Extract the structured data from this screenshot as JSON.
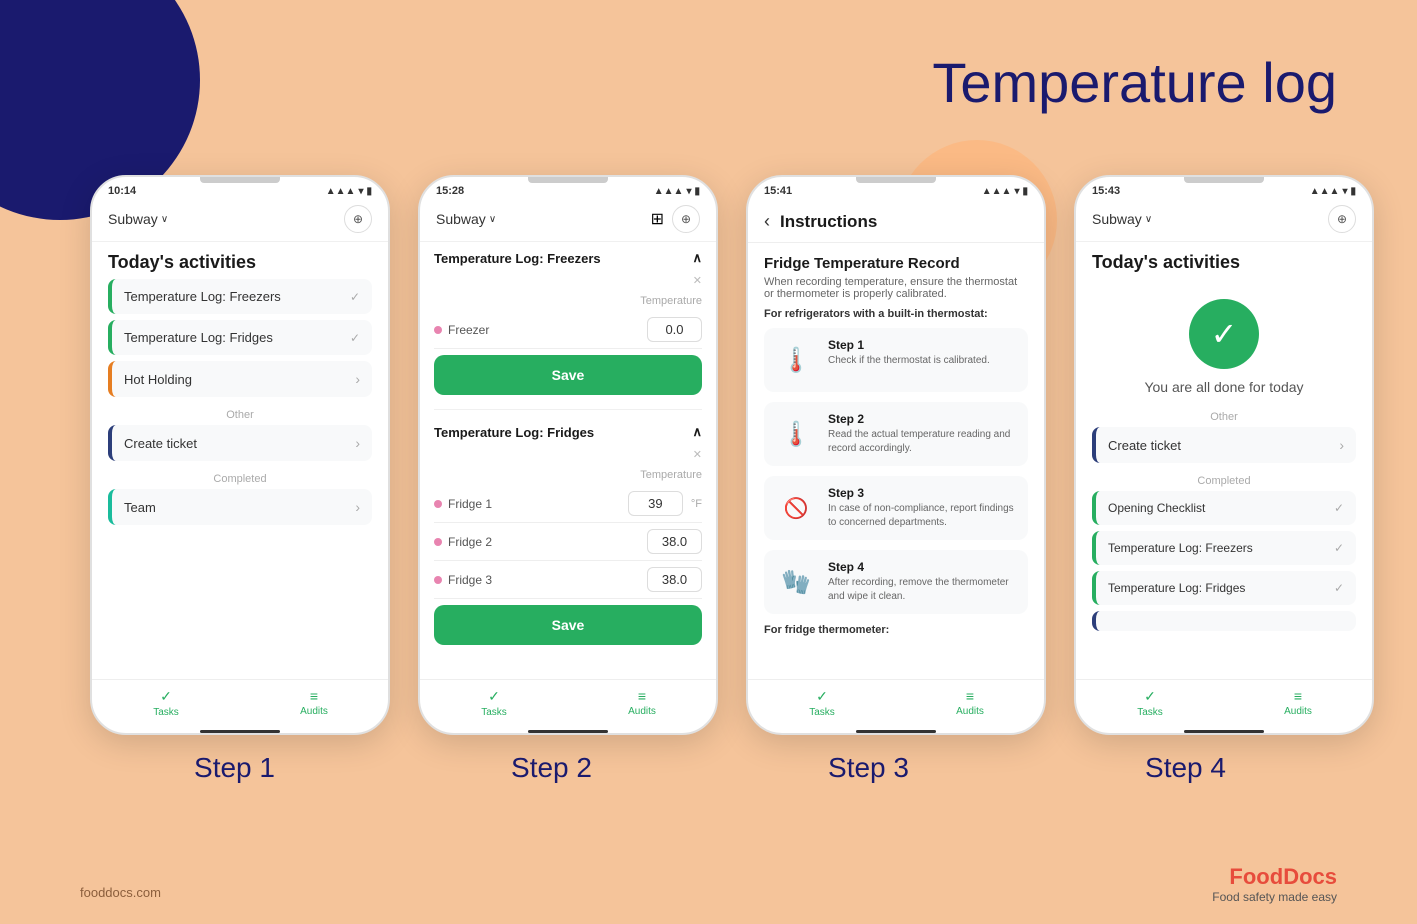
{
  "page": {
    "title": "Temperature log",
    "background_color": "#F5C49A"
  },
  "footer": {
    "website": "fooddocs.com",
    "brand": "FoodDocs",
    "brand_highlight": "D",
    "tagline": "Food safety made easy"
  },
  "steps": [
    {
      "id": 1,
      "label": "Step 1",
      "phone": {
        "time": "10:14",
        "store": "Subway",
        "section_title": "Today's activities",
        "tasks": [
          {
            "label": "Temperature Log: Freezers",
            "border": "green",
            "action": "check"
          },
          {
            "label": "Temperature Log: Fridges",
            "border": "green",
            "action": "check"
          },
          {
            "label": "Hot Holding",
            "border": "orange",
            "action": "chevron"
          }
        ],
        "separator": "Other",
        "other_tasks": [
          {
            "label": "Create ticket",
            "border": "blue",
            "action": "chevron"
          }
        ],
        "separator2": "Completed",
        "completed_tasks": [
          {
            "label": "Team",
            "border": "teal",
            "action": "chevron"
          }
        ],
        "nav": [
          {
            "icon": "✓",
            "label": "Tasks"
          },
          {
            "icon": "≡✓",
            "label": "Audits"
          }
        ]
      }
    },
    {
      "id": 2,
      "label": "Step 2",
      "phone": {
        "time": "15:28",
        "store": "Subway",
        "sections": [
          {
            "title": "Temperature Log: Freezers",
            "inputs": [
              {
                "label": "Temperature",
                "type": "header"
              },
              {
                "dot": "pink",
                "name": "Freezer",
                "value": "0.0",
                "unit": ""
              }
            ],
            "save_label": "Save"
          },
          {
            "title": "Temperature Log: Fridges",
            "inputs": [
              {
                "label": "Temperature",
                "type": "header"
              },
              {
                "dot": "pink",
                "name": "Fridge 1",
                "value": "39",
                "unit": "°F"
              },
              {
                "dot": "pink",
                "name": "Fridge 2",
                "value": "38.0",
                "unit": ""
              },
              {
                "dot": "pink",
                "name": "Fridge 3",
                "value": "38.0",
                "unit": ""
              }
            ],
            "save_label": "Save"
          }
        ],
        "nav": [
          {
            "icon": "✓",
            "label": "Tasks"
          },
          {
            "icon": "≡✓",
            "label": "Audits"
          }
        ]
      }
    },
    {
      "id": 3,
      "label": "Step 3",
      "phone": {
        "time": "15:41",
        "header": "Instructions",
        "main_title": "Fridge Temperature Record",
        "subtitle": "When recording temperature, ensure the thermostat or thermometer is properly calibrated.",
        "for_label": "For refrigerators with a built-in thermostat:",
        "steps": [
          {
            "icon": "🌡️",
            "title": "Step 1",
            "desc": "Check if the thermostat is calibrated."
          },
          {
            "icon": "🌡️",
            "title": "Step 2",
            "desc": "Read the actual temperature reading and record accordingly."
          },
          {
            "icon": "🚫",
            "title": "Step 3",
            "desc": "In case of non-compliance, report findings to concerned departments."
          },
          {
            "icon": "🧤",
            "title": "Step 4",
            "desc": "After recording, remove the thermometer and wipe it clean."
          }
        ],
        "footer_label": "For fridge thermometer:",
        "nav": [
          {
            "icon": "✓",
            "label": "Tasks"
          },
          {
            "icon": "≡✓",
            "label": "Audits"
          }
        ]
      }
    },
    {
      "id": 4,
      "label": "Step 4",
      "phone": {
        "time": "15:43",
        "store": "Subway",
        "section_title": "Today's activities",
        "done_text": "You are all done for today",
        "sections": [
          {
            "label": "Other",
            "items": [
              {
                "label": "Create ticket",
                "border": "blue",
                "action": "chevron"
              }
            ]
          },
          {
            "label": "Completed",
            "items": [
              {
                "label": "Opening Checklist",
                "border": "green",
                "action": "check"
              },
              {
                "label": "Temperature Log: Freezers",
                "border": "green",
                "action": "check"
              },
              {
                "label": "Temperature Log: Fridges",
                "border": "green",
                "action": "check"
              }
            ]
          }
        ],
        "nav": [
          {
            "icon": "✓",
            "label": "Tasks"
          },
          {
            "icon": "≡✓",
            "label": "Audits"
          }
        ]
      }
    }
  ]
}
